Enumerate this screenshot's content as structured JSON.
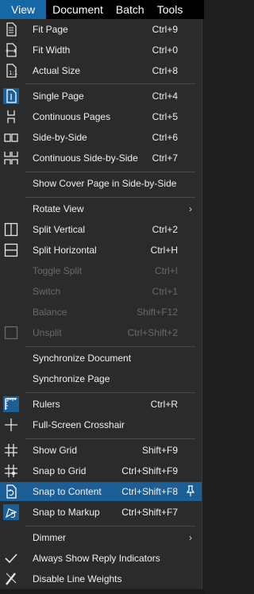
{
  "menubar": {
    "items": [
      "View",
      "Document",
      "Batch",
      "Tools"
    ]
  },
  "menu": {
    "fit_page": {
      "label": "Fit Page",
      "shortcut": "Ctrl+9"
    },
    "fit_width": {
      "label": "Fit Width",
      "shortcut": "Ctrl+0"
    },
    "actual_size": {
      "label": "Actual Size",
      "shortcut": "Ctrl+8"
    },
    "single_page": {
      "label": "Single Page",
      "shortcut": "Ctrl+4"
    },
    "continuous_pages": {
      "label": "Continuous Pages",
      "shortcut": "Ctrl+5"
    },
    "side_by_side": {
      "label": "Side-by-Side",
      "shortcut": "Ctrl+6"
    },
    "continuous_side_by_side": {
      "label": "Continuous Side-by-Side",
      "shortcut": "Ctrl+7"
    },
    "show_cover_page": {
      "label": "Show Cover Page in Side-by-Side"
    },
    "rotate_view": {
      "label": "Rotate View"
    },
    "split_vertical": {
      "label": "Split Vertical",
      "shortcut": "Ctrl+2"
    },
    "split_horizontal": {
      "label": "Split Horizontal",
      "shortcut": "Ctrl+H"
    },
    "toggle_split": {
      "label": "Toggle Split",
      "shortcut": "Ctrl+I"
    },
    "switch": {
      "label": "Switch",
      "shortcut": "Ctrl+1"
    },
    "balance": {
      "label": "Balance",
      "shortcut": "Shift+F12"
    },
    "unsplit": {
      "label": "Unsplit",
      "shortcut": "Ctrl+Shift+2"
    },
    "synchronize_document": {
      "label": "Synchronize Document"
    },
    "synchronize_page": {
      "label": "Synchronize Page"
    },
    "rulers": {
      "label": "Rulers",
      "shortcut": "Ctrl+R"
    },
    "full_screen_crosshair": {
      "label": "Full-Screen Crosshair"
    },
    "show_grid": {
      "label": "Show Grid",
      "shortcut": "Shift+F9"
    },
    "snap_to_grid": {
      "label": "Snap to Grid",
      "shortcut": "Ctrl+Shift+F9"
    },
    "snap_to_content": {
      "label": "Snap to Content",
      "shortcut": "Ctrl+Shift+F8"
    },
    "snap_to_markup": {
      "label": "Snap to Markup",
      "shortcut": "Ctrl+Shift+F7"
    },
    "dimmer": {
      "label": "Dimmer"
    },
    "always_show_reply_indicators": {
      "label": "Always Show Reply Indicators"
    },
    "disable_line_weights": {
      "label": "Disable Line Weights"
    }
  },
  "colors": {
    "accent": "#1b5f96",
    "menu_bg": "#2b2b2b",
    "menubar_bg": "#000000",
    "disabled_text": "#6a6a6a"
  },
  "icons": {
    "fit_page": "fit-page-icon",
    "fit_width": "fit-width-icon",
    "actual_size": "actual-size-icon",
    "single_page": "single-page-icon",
    "continuous_pages": "continuous-pages-icon",
    "side_by_side": "side-by-side-icon",
    "continuous_side_by_side": "continuous-side-by-side-icon",
    "split_vertical": "split-vertical-icon",
    "split_horizontal": "split-horizontal-icon",
    "unsplit": "unsplit-icon",
    "rulers": "rulers-icon",
    "crosshair": "crosshair-icon",
    "show_grid": "grid-icon",
    "snap_to_grid": "snap-grid-icon",
    "snap_to_content": "snap-content-icon",
    "snap_to_markup": "snap-markup-icon",
    "always_show_reply_indicators": "checkmark-icon",
    "disable_line_weights": "line-weights-icon",
    "pin": "pin-icon"
  }
}
